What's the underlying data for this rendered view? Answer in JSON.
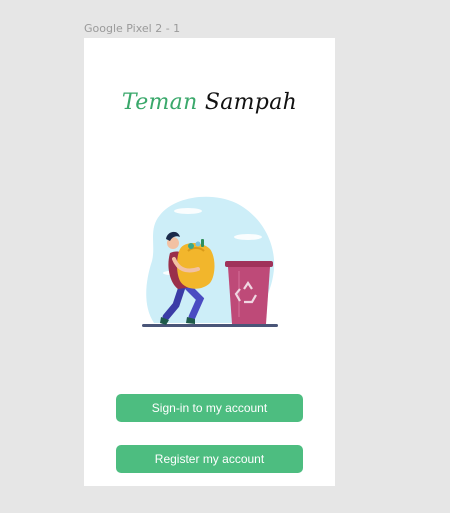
{
  "frame": {
    "label": "Google Pixel 2 - 1"
  },
  "app": {
    "logo_word1": "Teman",
    "logo_word2": "Sampah",
    "colors": {
      "accent": "#4dbd80",
      "logo_green": "#3aa86b",
      "frame_bg": "#e6e6e6"
    }
  },
  "illustration": {
    "name": "person-carrying-trash-bag-to-recycle-bin"
  },
  "buttons": {
    "signin_label": "Sign-in to my account",
    "register_label": "Register my account"
  }
}
